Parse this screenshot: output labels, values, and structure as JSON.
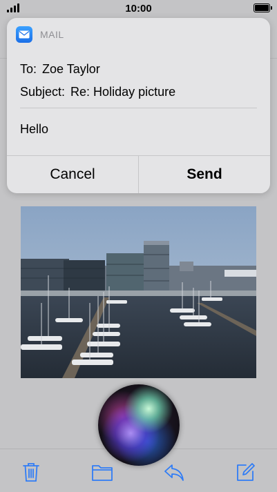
{
  "status_bar": {
    "time": "10:00"
  },
  "notification": {
    "app_name": "MAIL",
    "to_label": "To:",
    "to_value": "Zoe Taylor",
    "subject_label": "Subject:",
    "subject_value": "Re: Holiday picture",
    "body": "Hello",
    "cancel_label": "Cancel",
    "send_label": "Send"
  },
  "toolbar": {
    "icons": [
      "trash-icon",
      "folder-icon",
      "reply-icon",
      "compose-icon"
    ],
    "icon_color": "#2f7cf6"
  },
  "colors": {
    "accent": "#2f7cf6",
    "card_background": "#e4e4e6",
    "background": "#c4c4c6"
  }
}
